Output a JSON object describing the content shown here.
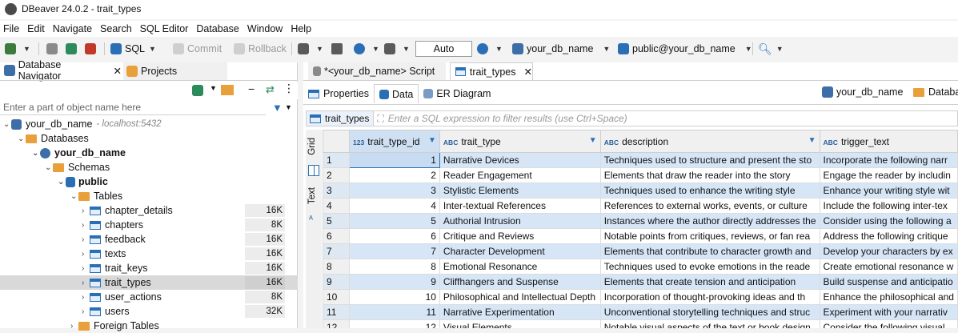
{
  "window": {
    "title": "DBeaver 24.0.2 - trait_types"
  },
  "menu": [
    "File",
    "Edit",
    "Navigate",
    "Search",
    "SQL Editor",
    "Database",
    "Window",
    "Help"
  ],
  "toolbar": {
    "sql": "SQL",
    "commit": "Commit",
    "rollback": "Rollback",
    "tx_mode": "Auto",
    "datasource": "your_db_name",
    "schema": "public@your_db_name"
  },
  "left_panel": {
    "tab_navigator": "Database Navigator",
    "tab_projects": "Projects",
    "filter_placeholder": "Enter a part of object name here",
    "connection": "your_db_name",
    "connection_host": "- localhost:5432",
    "databases": "Databases",
    "database": "your_db_name",
    "schemas": "Schemas",
    "schema": "public",
    "tables_folder": "Tables",
    "tables": [
      {
        "name": "chapter_details",
        "size": "16K"
      },
      {
        "name": "chapters",
        "size": "8K"
      },
      {
        "name": "feedback",
        "size": "16K"
      },
      {
        "name": "texts",
        "size": "16K"
      },
      {
        "name": "trait_keys",
        "size": "16K"
      },
      {
        "name": "trait_types",
        "size": "16K"
      },
      {
        "name": "user_actions",
        "size": "8K"
      },
      {
        "name": "users",
        "size": "32K"
      }
    ],
    "foreign_tables": "Foreign Tables"
  },
  "editor": {
    "tab_script": "*<your_db_name> Script",
    "tab_table": "trait_types",
    "subtab_properties": "Properties",
    "subtab_data": "Data",
    "subtab_er": "ER Diagram",
    "right_datasource": "your_db_name",
    "right_database": "Databa",
    "filter_label": "trait_types",
    "filter_placeholder": "Enter a SQL expression to filter results (use Ctrl+Space)",
    "vtab_grid": "Grid",
    "vtab_text": "Text"
  },
  "grid": {
    "columns": [
      {
        "type": "123",
        "name": "trait_type_id"
      },
      {
        "type": "ABC",
        "name": "trait_type"
      },
      {
        "type": "ABC",
        "name": "description"
      },
      {
        "type": "ABC",
        "name": "trigger_text"
      }
    ],
    "rows": [
      [
        "1",
        "1",
        "Narrative Devices",
        "Techniques used to structure and present the sto",
        "Incorporate the following narr"
      ],
      [
        "2",
        "2",
        "Reader Engagement",
        "Elements that draw the reader into the story",
        "Engage the reader by includin"
      ],
      [
        "3",
        "3",
        "Stylistic Elements",
        "Techniques used to enhance the writing style",
        "Enhance your writing style wit"
      ],
      [
        "4",
        "4",
        "Inter-textual References",
        "References to external works, events, or culture",
        "Include the following inter-tex"
      ],
      [
        "5",
        "5",
        "Authorial Intrusion",
        "Instances where the author directly addresses the",
        "Consider using the following a"
      ],
      [
        "6",
        "6",
        "Critique and Reviews",
        "Notable points from critiques, reviews, or fan rea",
        "Address the following critique"
      ],
      [
        "7",
        "7",
        "Character Development",
        "Elements that contribute to character growth and",
        "Develop your characters by ex"
      ],
      [
        "8",
        "8",
        "Emotional Resonance",
        "Techniques used to evoke emotions in the reade",
        "Create emotional resonance w"
      ],
      [
        "9",
        "9",
        "Cliffhangers and Suspense",
        "Elements that create tension and anticipation",
        "Build suspense and anticipatio"
      ],
      [
        "10",
        "10",
        "Philosophical and Intellectual Depth",
        "Incorporation of thought-provoking ideas and th",
        "Enhance the philosophical and"
      ],
      [
        "11",
        "11",
        "Narrative Experimentation",
        "Unconventional storytelling techniques and struc",
        "Experiment with your narrativ"
      ],
      [
        "12",
        "12",
        "Visual Elements",
        "Notable visual aspects of the text or book design",
        "Consider the following visual"
      ]
    ]
  }
}
